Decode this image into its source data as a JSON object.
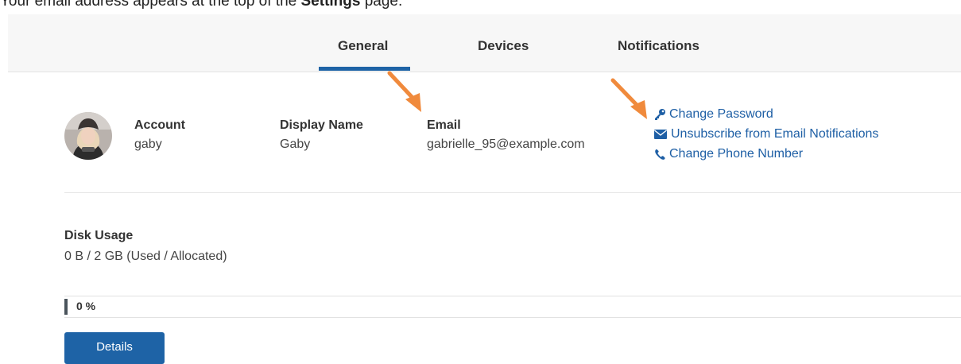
{
  "caption": {
    "prefix": "Your email address appears at the top of the ",
    "bold": "Settings",
    "suffix": " page."
  },
  "tabs": [
    {
      "label": "General",
      "active": true
    },
    {
      "label": "Devices",
      "active": false
    },
    {
      "label": "Notifications",
      "active": false
    }
  ],
  "account": {
    "account_label": "Account",
    "account_value": "gaby",
    "display_name_label": "Display Name",
    "display_name_value": "Gaby",
    "email_label": "Email",
    "email_value": "gabrielle_95@example.com"
  },
  "links": [
    {
      "label": "Change Password",
      "icon": "key-icon"
    },
    {
      "label": "Unsubscribe from Email Notifications",
      "icon": "envelope-icon"
    },
    {
      "label": "Change Phone Number",
      "icon": "phone-icon"
    }
  ],
  "disk": {
    "title": "Disk Usage",
    "usage": "0 B / 2 GB (Used / Allocated)",
    "percent_label": "0 %",
    "percent": 0
  },
  "details_button": "Details",
  "colors": {
    "accent": "#1e63a6",
    "link": "#1e5fa5",
    "annotation_arrow": "#f08a3c"
  }
}
